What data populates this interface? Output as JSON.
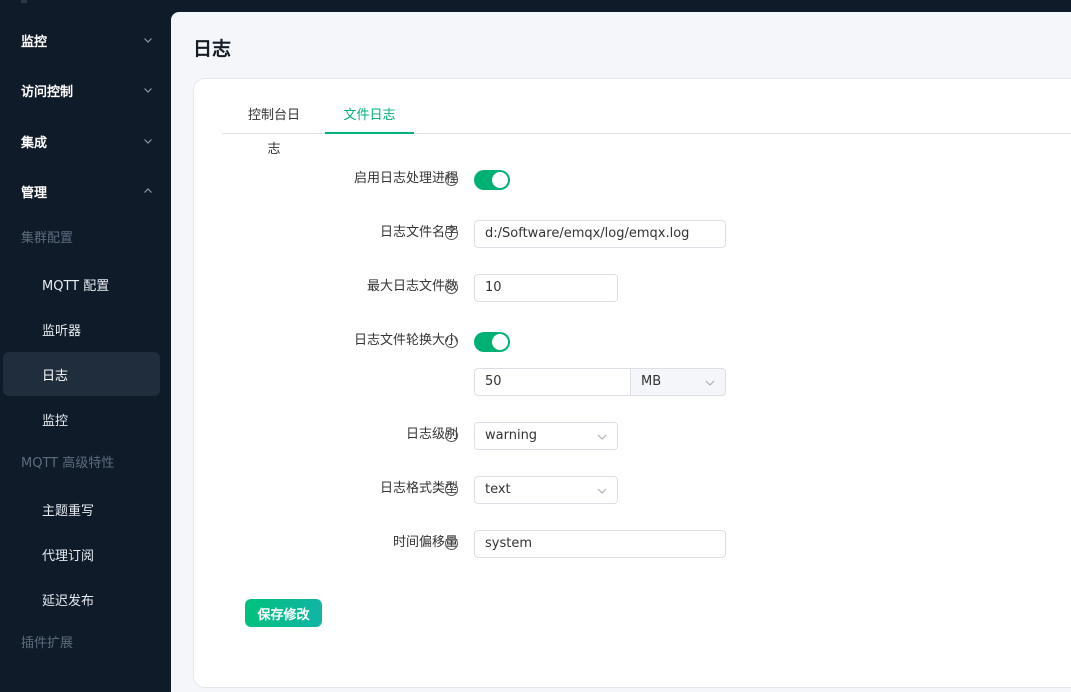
{
  "sidebar": {
    "menu": [
      {
        "label": "监控",
        "expanded": false
      },
      {
        "label": "访问控制",
        "expanded": false
      },
      {
        "label": "集成",
        "expanded": false
      },
      {
        "label": "管理",
        "expanded": true
      }
    ],
    "group_cluster": "集群配置",
    "cluster_items": [
      {
        "label": "MQTT 配置"
      },
      {
        "label": "监听器"
      },
      {
        "label": "日志",
        "active": true
      },
      {
        "label": "监控"
      }
    ],
    "group_mqtt_advanced": "MQTT 高级特性",
    "advanced_items": [
      {
        "label": "主题重写"
      },
      {
        "label": "代理订阅"
      },
      {
        "label": "延迟发布"
      }
    ],
    "group_plugins": "插件扩展"
  },
  "page": {
    "title": "日志"
  },
  "tabs": [
    {
      "label": "控制台日志",
      "active": false
    },
    {
      "label": "文件日志",
      "active": true
    }
  ],
  "form": {
    "enable_handler": {
      "label": "启用日志处理进程",
      "enabled": true
    },
    "file_name": {
      "label": "日志文件名字",
      "value": "d:/Software/emqx/log/emqx.log"
    },
    "max_files": {
      "label": "最大日志文件数",
      "value": "10"
    },
    "rotation_size": {
      "label": "日志文件轮换大小",
      "enabled": true,
      "value": "50",
      "unit": "MB"
    },
    "level": {
      "label": "日志级别",
      "value": "warning"
    },
    "formatter": {
      "label": "日志格式类型",
      "value": "text"
    },
    "time_offset": {
      "label": "时间偏移量",
      "value": "system"
    }
  },
  "buttons": {
    "save": "保存修改"
  },
  "icons": {
    "help": "question-circle-icon",
    "chevron": "chevron-icon"
  },
  "colors": {
    "accent": "#00b173",
    "sidebar_bg": "#0f1b29",
    "active_item_bg": "#1f2d3d"
  }
}
